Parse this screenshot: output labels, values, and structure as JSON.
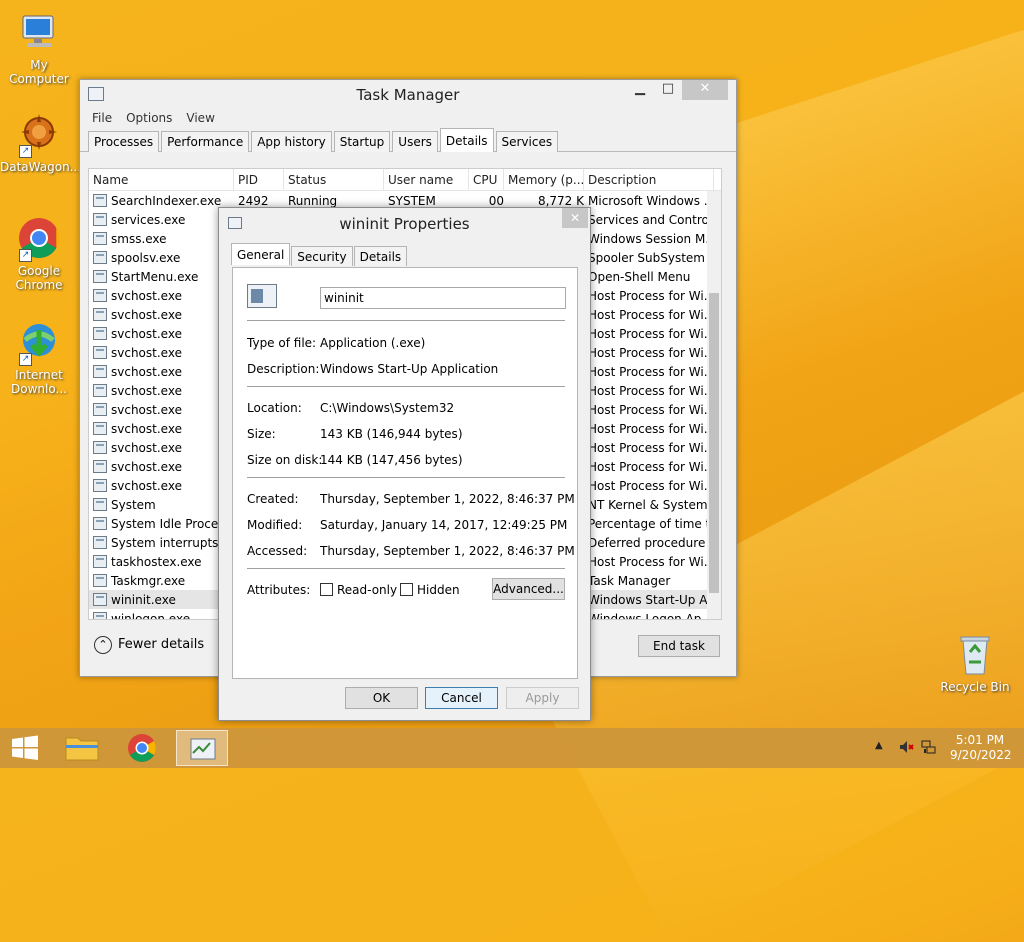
{
  "desktop": {
    "icons": [
      {
        "label": "My Computer",
        "icon": "computer-icon"
      },
      {
        "label": "DataWagon...",
        "icon": "datawagon-icon"
      },
      {
        "label": "Google Chrome",
        "icon": "chrome-icon"
      },
      {
        "label": "Internet Downlo...",
        "icon": "idm-icon"
      },
      {
        "label": "Recycle Bin",
        "icon": "recycle-bin-icon"
      }
    ]
  },
  "taskmgr": {
    "title": "Task Manager",
    "menu": [
      "File",
      "Options",
      "View"
    ],
    "tabs": [
      "Processes",
      "Performance",
      "App history",
      "Startup",
      "Users",
      "Details",
      "Services"
    ],
    "active_tab": "Details",
    "columns": [
      "Name",
      "PID",
      "Status",
      "User name",
      "CPU",
      "Memory (p...",
      "Description"
    ],
    "rows": [
      {
        "name": "SearchIndexer.exe",
        "pid": "2492",
        "status": "Running",
        "user": "SYSTEM",
        "cpu": "00",
        "mem": "8,772 K",
        "desc": "Microsoft Windows ..."
      },
      {
        "name": "services.exe",
        "desc": "Services and Control..."
      },
      {
        "name": "smss.exe",
        "desc": "Windows Session M..."
      },
      {
        "name": "spoolsv.exe",
        "desc": "Spooler SubSystem ..."
      },
      {
        "name": "StartMenu.exe",
        "desc": "Open-Shell Menu"
      },
      {
        "name": "svchost.exe",
        "desc": "Host Process for Wi..."
      },
      {
        "name": "svchost.exe",
        "desc": "Host Process for Wi..."
      },
      {
        "name": "svchost.exe",
        "desc": "Host Process for Wi..."
      },
      {
        "name": "svchost.exe",
        "desc": "Host Process for Wi..."
      },
      {
        "name": "svchost.exe",
        "desc": "Host Process for Wi..."
      },
      {
        "name": "svchost.exe",
        "desc": "Host Process for Wi..."
      },
      {
        "name": "svchost.exe",
        "desc": "Host Process for Wi..."
      },
      {
        "name": "svchost.exe",
        "desc": "Host Process for Wi..."
      },
      {
        "name": "svchost.exe",
        "desc": "Host Process for Wi..."
      },
      {
        "name": "svchost.exe",
        "desc": "Host Process for Wi..."
      },
      {
        "name": "svchost.exe",
        "desc": "Host Process for Wi..."
      },
      {
        "name": "System",
        "desc": "NT Kernel & System"
      },
      {
        "name": "System Idle Process",
        "desc": "Percentage of time t..."
      },
      {
        "name": "System interrupts",
        "desc": "Deferred procedure ..."
      },
      {
        "name": "taskhostex.exe",
        "desc": "Host Process for Wi..."
      },
      {
        "name": "Taskmgr.exe",
        "desc": "Task Manager"
      },
      {
        "name": "wininit.exe",
        "desc": "Windows Start-Up A..."
      },
      {
        "name": "winlogon.exe",
        "desc": "Windows Logon Ap..."
      }
    ],
    "fewer_details": "Fewer details",
    "end_task": "End task"
  },
  "props": {
    "title": "wininit Properties",
    "tabs": [
      "General",
      "Security",
      "Details"
    ],
    "filename": "wininit",
    "type_label": "Type of file:",
    "type_value": "Application (.exe)",
    "desc_label": "Description:",
    "desc_value": "Windows Start-Up Application",
    "loc_label": "Location:",
    "loc_value": "C:\\Windows\\System32",
    "size_label": "Size:",
    "size_value": "143 KB (146,944 bytes)",
    "sod_label": "Size on disk:",
    "sod_value": "144 KB (147,456 bytes)",
    "created_label": "Created:",
    "created_value": "Thursday, September 1, 2022, 8:46:37 PM",
    "modified_label": "Modified:",
    "modified_value": "Saturday, January 14, 2017, 12:49:25 PM",
    "accessed_label": "Accessed:",
    "accessed_value": "Thursday, September 1, 2022, 8:46:37 PM",
    "attr_label": "Attributes:",
    "readonly": "Read-only",
    "hidden": "Hidden",
    "advanced": "Advanced...",
    "ok": "OK",
    "cancel": "Cancel",
    "apply": "Apply"
  },
  "taskbar": {
    "time": "5:01 PM",
    "date": "9/20/2022"
  }
}
